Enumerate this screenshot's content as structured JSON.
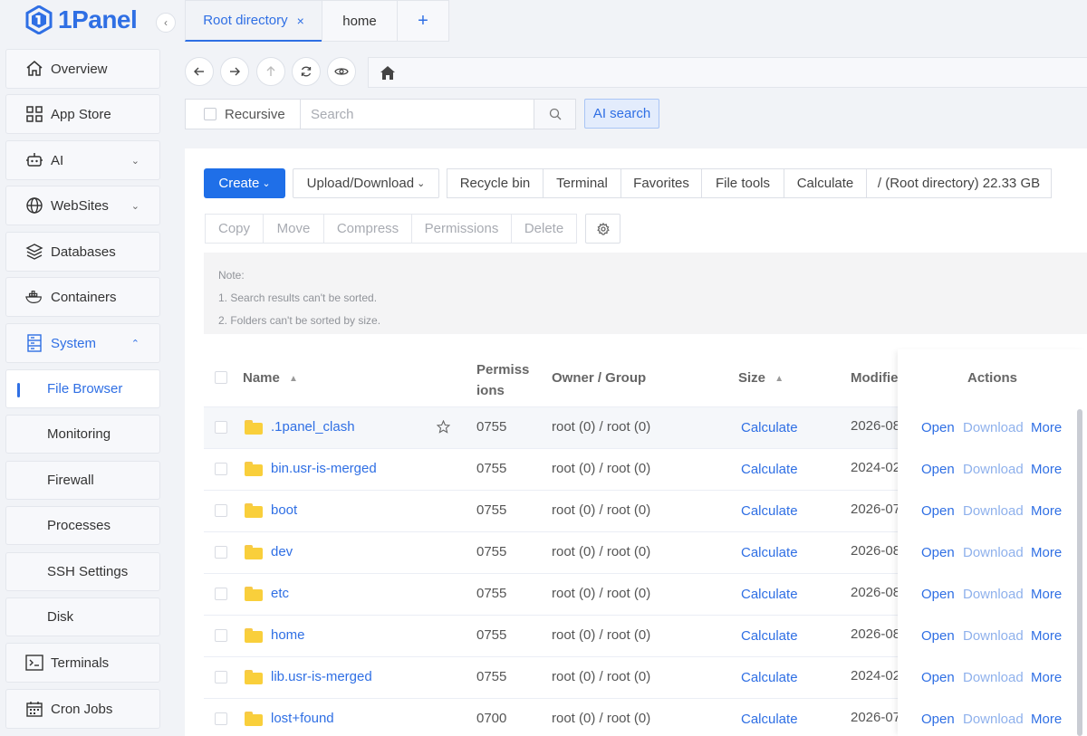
{
  "app": {
    "name": "1Panel"
  },
  "sidebar": {
    "items": [
      {
        "label": "Overview",
        "icon": "home-icon"
      },
      {
        "label": "App Store",
        "icon": "grid-icon"
      },
      {
        "label": "AI",
        "icon": "robot-icon",
        "chevron": "down"
      },
      {
        "label": "WebSites",
        "icon": "globe-icon",
        "chevron": "down"
      },
      {
        "label": "Databases",
        "icon": "layers-icon"
      },
      {
        "label": "Containers",
        "icon": "docker-icon"
      },
      {
        "label": "System",
        "icon": "server-icon",
        "chevron": "up",
        "expanded": true
      },
      {
        "label": "Terminals",
        "icon": "terminal-icon"
      },
      {
        "label": "Cron Jobs",
        "icon": "calendar-icon"
      }
    ],
    "system_children": [
      {
        "label": "File Browser",
        "active": true
      },
      {
        "label": "Monitoring"
      },
      {
        "label": "Firewall"
      },
      {
        "label": "Processes"
      },
      {
        "label": "SSH Settings"
      },
      {
        "label": "Disk"
      }
    ]
  },
  "tabs": [
    {
      "label": "Root directory",
      "active": true,
      "closable": true
    },
    {
      "label": "home"
    }
  ],
  "search": {
    "recursive_label": "Recursive",
    "placeholder": "Search",
    "ai_label": "AI search"
  },
  "toolbar": {
    "create_label": "Create",
    "upload_label": "Upload/Download",
    "buttons": [
      "Recycle bin",
      "Terminal",
      "Favorites",
      "File tools",
      "Calculate",
      "/ (Root directory) 22.33 GB"
    ],
    "batch_buttons": [
      "Copy",
      "Move",
      "Compress",
      "Permissions",
      "Delete"
    ]
  },
  "note": {
    "title": "Note:",
    "lines": [
      "1. Search results can't be sorted.",
      "2. Folders can't be sorted by size."
    ]
  },
  "table": {
    "headers": {
      "name": "Name",
      "permissions_1": "Permiss",
      "permissions_2": "ions",
      "owner": "Owner / Group",
      "size": "Size",
      "modified": "Modifie",
      "actions": "Actions"
    },
    "rows": [
      {
        "name": ".1panel_clash",
        "perm": "0755",
        "owner": "root (0) / root (0)",
        "size": "Calculate",
        "modified": "2026-08",
        "favorite_star": true
      },
      {
        "name": "bin.usr-is-merged",
        "perm": "0755",
        "owner": "root (0) / root (0)",
        "size": "Calculate",
        "modified": "2024-02"
      },
      {
        "name": "boot",
        "perm": "0755",
        "owner": "root (0) / root (0)",
        "size": "Calculate",
        "modified": "2026-07"
      },
      {
        "name": "dev",
        "perm": "0755",
        "owner": "root (0) / root (0)",
        "size": "Calculate",
        "modified": "2026-08"
      },
      {
        "name": "etc",
        "perm": "0755",
        "owner": "root (0) / root (0)",
        "size": "Calculate",
        "modified": "2026-08"
      },
      {
        "name": "home",
        "perm": "0755",
        "owner": "root (0) / root (0)",
        "size": "Calculate",
        "modified": "2026-08"
      },
      {
        "name": "lib.usr-is-merged",
        "perm": "0755",
        "owner": "root (0) / root (0)",
        "size": "Calculate",
        "modified": "2024-02"
      },
      {
        "name": "lost+found",
        "perm": "0700",
        "owner": "root (0) / root (0)",
        "size": "Calculate",
        "modified": "2026-07"
      }
    ],
    "row_actions": {
      "open": "Open",
      "download": "Download",
      "more": "More"
    }
  },
  "colors": {
    "accent": "#2f6fe4",
    "primary_button": "#1f6fe8",
    "folder": "#f9cf3b"
  }
}
